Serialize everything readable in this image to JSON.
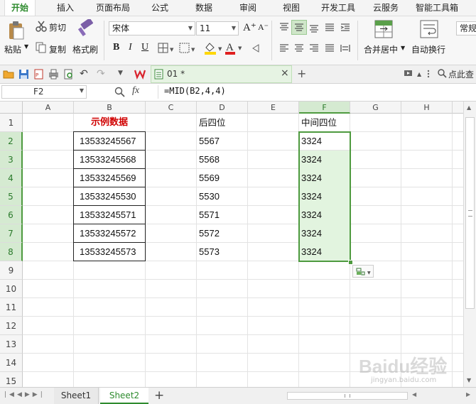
{
  "menu": {
    "tabs": [
      "开始",
      "插入",
      "页面布局",
      "公式",
      "数据",
      "审阅",
      "视图",
      "开发工具",
      "云服务",
      "智能工具箱"
    ],
    "active_index": 0
  },
  "ribbon": {
    "paste_label": "粘贴",
    "cut_label": "剪切",
    "copy_label": "复制",
    "format_painter_label": "格式刷",
    "font_name": "宋体",
    "font_size": "11",
    "merge_center_label": "合并居中",
    "wrap_text_label": "自动换行",
    "number_format": "常规",
    "bold": "B",
    "italic": "I",
    "underline": "U",
    "font_color_letter": "A",
    "grow_font": "A⁺",
    "shrink_font": "A⁻",
    "accent_color": "#2e8b2e",
    "fill_color": "#ffd700",
    "font_color": "#e02020"
  },
  "qabar": {
    "doc_name": "01 *",
    "search_label": "点此查"
  },
  "formula_bar": {
    "name_box": "F2",
    "fx_label": "fx",
    "formula": "=MID(B2,4,4)"
  },
  "sheet": {
    "columns": [
      "A",
      "B",
      "C",
      "D",
      "E",
      "F",
      "G",
      "H"
    ],
    "selected_column": "F",
    "rows": [
      "1",
      "2",
      "3",
      "4",
      "5",
      "6",
      "7",
      "8",
      "9",
      "10",
      "11",
      "12",
      "13",
      "14",
      "15"
    ],
    "header_b": "示例数据",
    "header_d": "后四位",
    "header_f": "中间四位",
    "col_b": [
      "13533245567",
      "13533245568",
      "13533245569",
      "13533245530",
      "13533245571",
      "13533245572",
      "13533245573"
    ],
    "col_d": [
      "5567",
      "5568",
      "5569",
      "5530",
      "5571",
      "5572",
      "5573"
    ],
    "col_f": [
      "3324",
      "3324",
      "3324",
      "3324",
      "3324",
      "3324",
      "3324"
    ],
    "header_b_color": "#d00000",
    "selection_color": "#4e9a3f",
    "selection_fill": "#e2f4df"
  },
  "sheet_tabs": [
    "Sheet1",
    "Sheet2"
  ],
  "active_sheet": "Sheet2",
  "watermark": {
    "text": "Baidu经验",
    "url": "jingyan.baidu.com"
  }
}
